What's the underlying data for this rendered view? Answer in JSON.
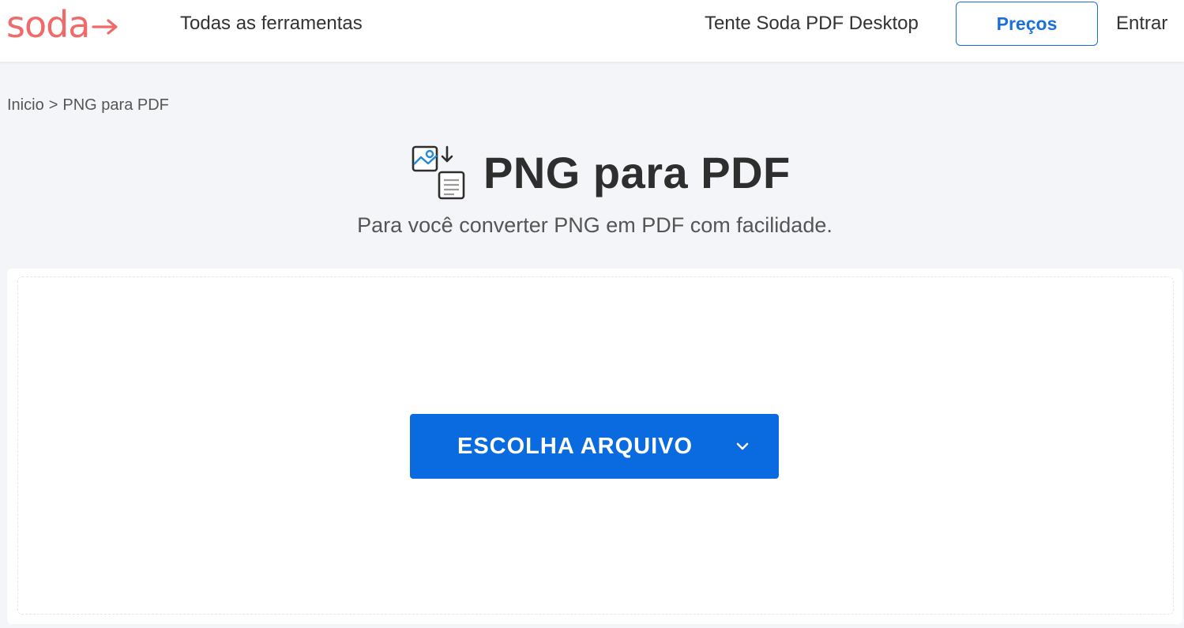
{
  "header": {
    "logo_text": "soda",
    "all_tools": "Todas as ferramentas",
    "try_desktop": "Tente Soda PDF Desktop",
    "pricing": "Preços",
    "login": "Entrar"
  },
  "breadcrumb": {
    "home": "Inicio",
    "separator": ">",
    "current": "PNG para PDF"
  },
  "main": {
    "title": "PNG para PDF",
    "subtitle": "Para você converter PNG em PDF com facilidade.",
    "title_icon": "image-to-document-icon"
  },
  "upload": {
    "button_label": "ESCOLHA ARQUIVO",
    "button_icon": "chevron-down-icon"
  },
  "colors": {
    "brand": "#f06a6a",
    "primary": "#0a6be0",
    "background": "#f4f5f8"
  }
}
